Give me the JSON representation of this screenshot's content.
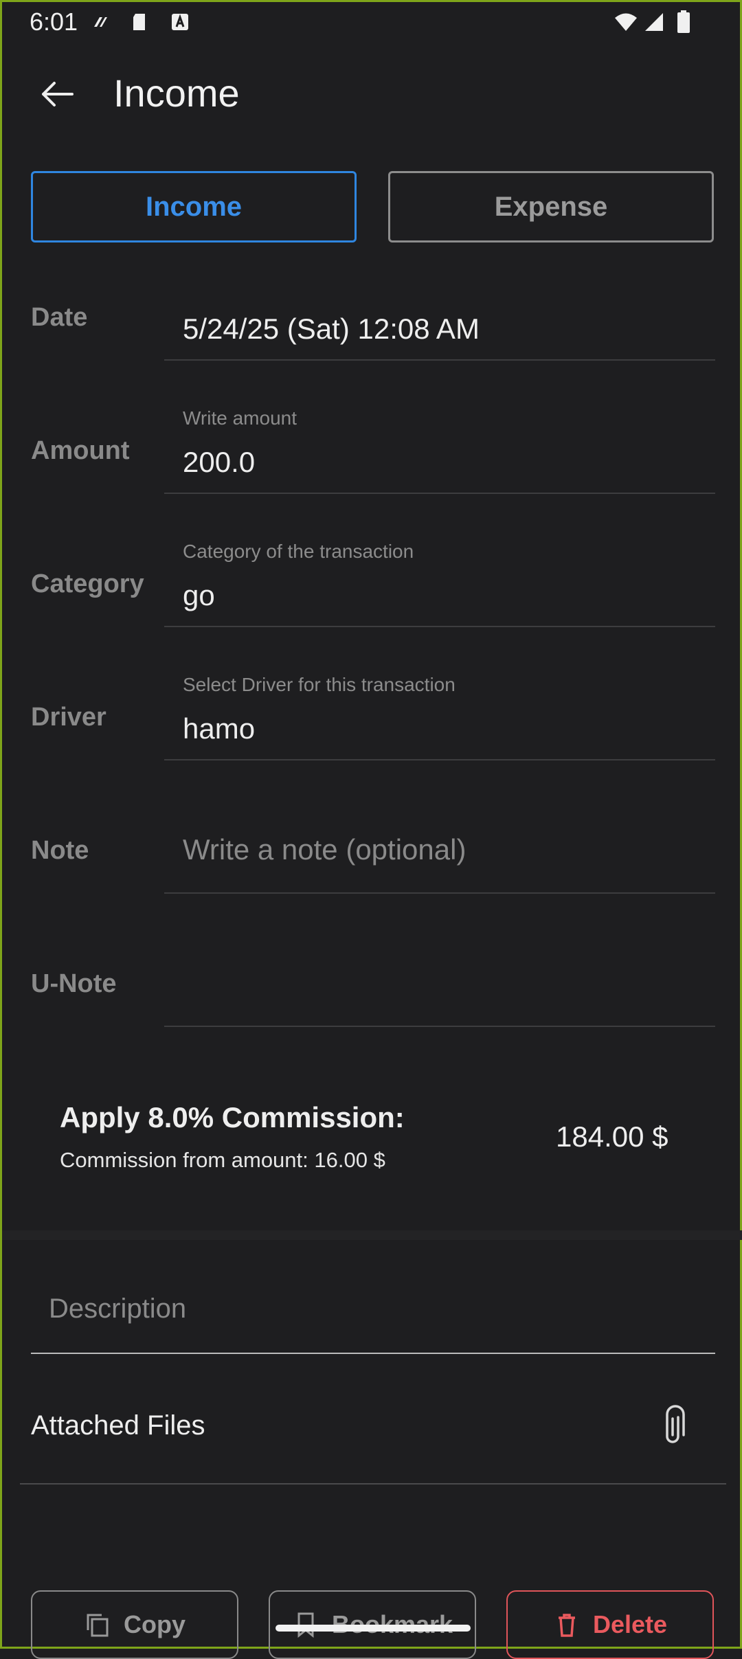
{
  "status_bar": {
    "time": "6:01"
  },
  "app_bar": {
    "title": "Income"
  },
  "type_toggle": {
    "income_label": "Income",
    "expense_label": "Expense",
    "selected": "Income"
  },
  "form": {
    "date": {
      "label": "Date",
      "value": "5/24/25 (Sat) 12:08 AM"
    },
    "amount": {
      "label": "Amount",
      "hint": "Write amount",
      "value": "200.0"
    },
    "category": {
      "label": "Category",
      "hint": "Category of the transaction",
      "value": "go"
    },
    "driver": {
      "label": "Driver",
      "hint": "Select Driver for this transaction",
      "value": "hamo"
    },
    "note": {
      "label": "Note",
      "placeholder": "Write a note (optional)"
    },
    "unote": {
      "label": "U-Note",
      "value": ""
    }
  },
  "commission": {
    "title": "Apply 8.0% Commission:",
    "subtitle": "Commission from amount: 16.00 $",
    "total": "184.00 $"
  },
  "description": {
    "placeholder": "Description"
  },
  "attached_files": {
    "label": "Attached Files",
    "icon": "paperclip-icon"
  },
  "actions": {
    "copy": "Copy",
    "bookmark": "Bookmark",
    "delete": "Delete"
  },
  "colors": {
    "background": "#1e1e20",
    "accent": "#2f86e0",
    "danger": "#e0555a"
  }
}
